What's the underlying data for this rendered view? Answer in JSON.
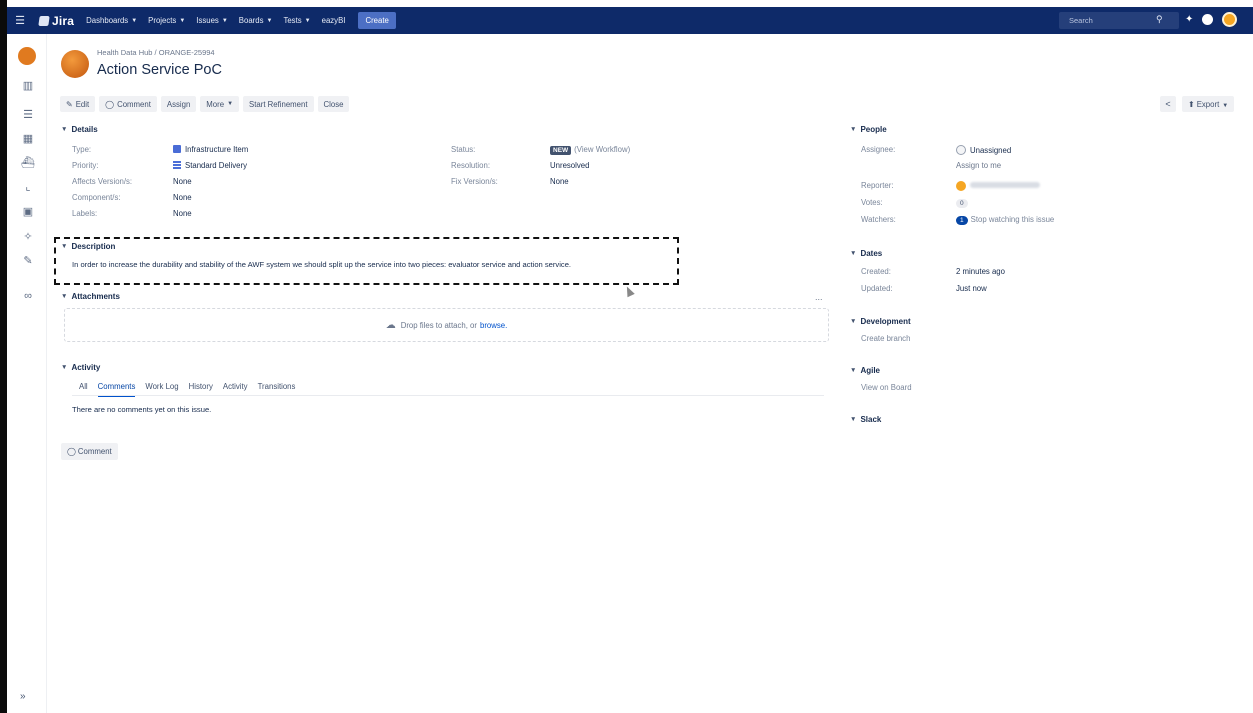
{
  "topnav": {
    "menu_icon": "hamburger-icon",
    "logo": "Jira",
    "items": [
      {
        "label": "Dashboards"
      },
      {
        "label": "Projects"
      },
      {
        "label": "Issues"
      },
      {
        "label": "Boards"
      },
      {
        "label": "Tests"
      },
      {
        "label": "eazyBI"
      }
    ],
    "create_label": "Create",
    "search_placeholder": "Search",
    "accent": "#0e2a69"
  },
  "sidebar": {
    "icons": [
      "project-avatar",
      "backlog-icon",
      "board-icon",
      "columns-icon",
      "releases-icon",
      "reports-icon",
      "issues-icon",
      "components-icon",
      "tests-icon",
      "link-icon"
    ],
    "expand_label": "»"
  },
  "issue": {
    "project": "Health Data Hub",
    "separator": "/",
    "key": "ORANGE-25994",
    "title": "Action Service PoC"
  },
  "toolbar": {
    "edit": "Edit",
    "comment": "Comment",
    "assign": "Assign",
    "more": "More",
    "start_refinement": "Start Refinement",
    "close": "Close",
    "export": "Export"
  },
  "details": {
    "heading": "Details",
    "type_label": "Type:",
    "type_value": "Infrastructure Item",
    "priority_label": "Priority:",
    "priority_value": "Standard Delivery",
    "affects_label": "Affects Version/s:",
    "affects_value": "None",
    "component_label": "Component/s:",
    "component_value": "None",
    "labels_label": "Labels:",
    "labels_value": "None",
    "status_label": "Status:",
    "status_badge": "NEW",
    "status_link": "(View Workflow)",
    "resolution_label": "Resolution:",
    "resolution_value": "Unresolved",
    "fix_label": "Fix Version/s:",
    "fix_value": "None"
  },
  "description": {
    "heading": "Description",
    "text": "In order to increase the durability and stability of the AWF system we should split up the service into two pieces: evaluator service and action service."
  },
  "attachments": {
    "heading": "Attachments",
    "drop_text": "Drop files to attach, or",
    "browse": "browse.",
    "more": "..."
  },
  "activity": {
    "heading": "Activity",
    "tabs": [
      "All",
      "Comments",
      "Work Log",
      "History",
      "Activity",
      "Transitions"
    ],
    "active_tab": "Comments",
    "empty_text": "There are no comments yet on this issue.",
    "comment_button": "Comment"
  },
  "people": {
    "heading": "People",
    "assignee_label": "Assignee:",
    "assignee_value": "Unassigned",
    "assign_to_me": "Assign to me",
    "reporter_label": "Reporter:",
    "votes_label": "Votes:",
    "votes_value": "0",
    "watchers_label": "Watchers:",
    "watchers_count": "1",
    "watchers_text": "Stop watching this issue"
  },
  "dates": {
    "heading": "Dates",
    "created_label": "Created:",
    "created_value": "2 minutes ago",
    "updated_label": "Updated:",
    "updated_value": "Just now"
  },
  "development": {
    "heading": "Development",
    "create_branch": "Create branch"
  },
  "agile": {
    "heading": "Agile",
    "view_on_board": "View on Board"
  },
  "slack": {
    "heading": "Slack"
  }
}
